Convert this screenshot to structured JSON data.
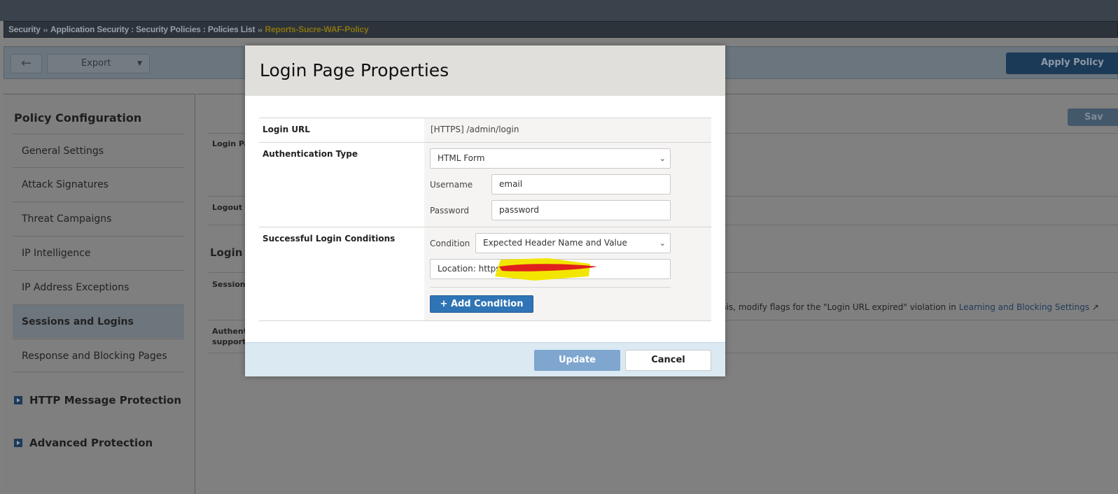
{
  "breadcrumb": {
    "items": [
      "Security",
      "Application Security : Security Policies : Policies List"
    ],
    "current": "Reports-Sucre-WAF-Policy",
    "separator": "››"
  },
  "toolbar": {
    "back_icon": "←",
    "export_label": "Export",
    "export_caret": "▼",
    "apply_label": "Apply Policy"
  },
  "sidebar": {
    "title": "Policy Configuration",
    "items": [
      {
        "label": "General Settings"
      },
      {
        "label": "Attack Signatures"
      },
      {
        "label": "Threat Campaigns"
      },
      {
        "label": "IP Intelligence"
      },
      {
        "label": "IP Address Exceptions"
      },
      {
        "label": "Sessions and Logins"
      },
      {
        "label": "Response and Blocking Pages"
      }
    ],
    "groups": [
      {
        "label": "HTTP Message Protection"
      },
      {
        "label": "Advanced Protection"
      }
    ]
  },
  "background": {
    "save_label": "Sav",
    "labels": [
      "Login Pa",
      "Logout F",
      "Session",
      "Authent",
      "support"
    ],
    "heading": "Login I",
    "note": "his, modify flags for the \"Login URL expired\" violation in ",
    "note_link": "Learning and Blocking Settings",
    "external_icon": "↗"
  },
  "modal": {
    "title": "Login Page Properties",
    "login_url": {
      "label": "Login URL",
      "value": "[HTTPS] /admin/login"
    },
    "auth": {
      "label": "Authentication Type",
      "type": "HTML Form",
      "username_label": "Username",
      "username": "email",
      "password_label": "Password",
      "password": "password"
    },
    "conditions": {
      "label": "Successful Login Conditions",
      "condition_label": "Condition",
      "condition": "Expected Header Name and Value",
      "value": "Location: https://",
      "add_label": "Add Condition",
      "add_icon": "+"
    },
    "update_label": "Update",
    "cancel_label": "Cancel"
  }
}
